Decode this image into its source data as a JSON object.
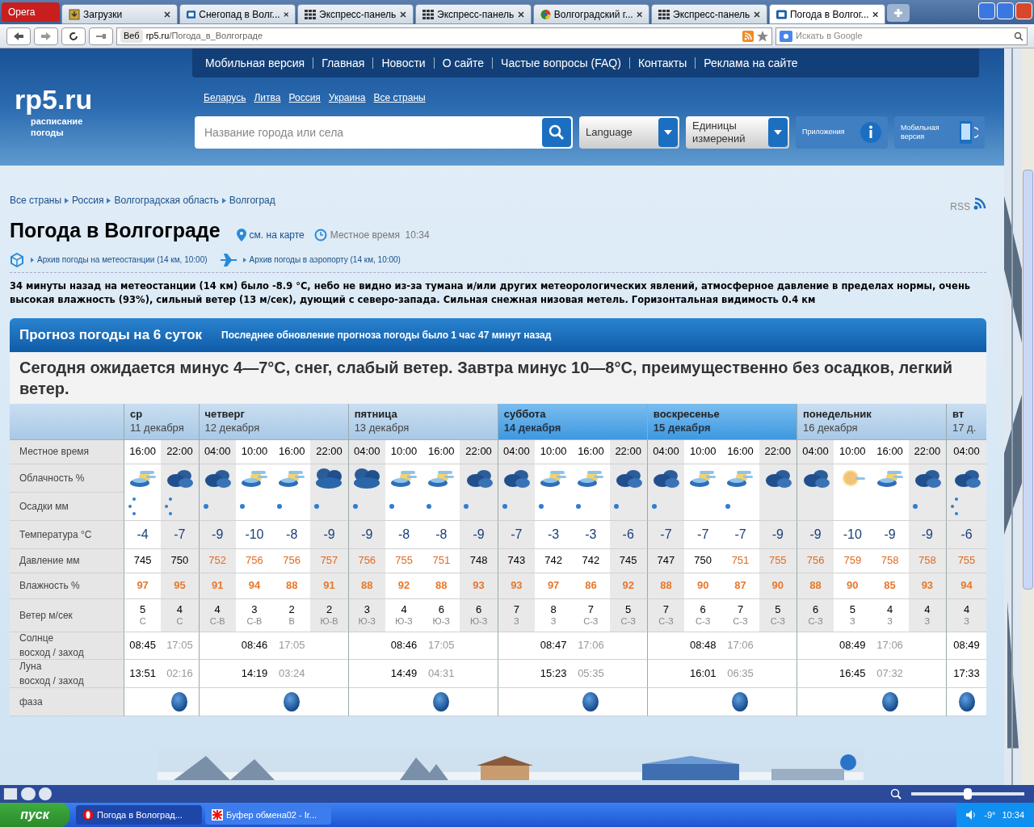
{
  "browser": {
    "menu": "Opera",
    "tabs": [
      {
        "label": "Загрузки",
        "kind": "download",
        "selected": false
      },
      {
        "label": "Снегопад в Волг...",
        "kind": "site",
        "selected": false
      },
      {
        "label": "Экспресс-панель",
        "kind": "grid",
        "selected": false
      },
      {
        "label": "Экспресс-панель",
        "kind": "grid",
        "selected": false
      },
      {
        "label": "Волгоградский г...",
        "kind": "globe",
        "selected": false
      },
      {
        "label": "Экспресс-панель",
        "kind": "grid",
        "selected": false
      },
      {
        "label": "Погода в Волгог...",
        "kind": "site",
        "selected": true
      }
    ],
    "badge": "Веб",
    "url_host": "rp5.ru",
    "url_path": "/Погода_в_Волгограде",
    "search_placeholder": "Искать в Google",
    "zoom": {
      "level": 0.5
    }
  },
  "header": {
    "nav": [
      "Мобильная версия",
      "Главная",
      "Новости",
      "О сайте",
      "Частые вопросы (FAQ)",
      "Контакты",
      "Реклама на сайте"
    ],
    "countries": [
      "Беларусь",
      "Литва",
      "Россия",
      "Украина",
      "Все страны"
    ],
    "logo": "rp5.ru",
    "tagline": "расписание погоды",
    "search_placeholder": "Название города или села",
    "language": "Language",
    "units": "Единицы измерений",
    "apps": "Приложения",
    "mobile": "Мобильная версия"
  },
  "breadcrumbs": [
    "Все страны",
    "Россия",
    "Волгоградская область",
    "Волгоград"
  ],
  "rss": "RSS",
  "title": "Погода в Волгограде",
  "map_link": "см. на карте",
  "local_time": "Местное время  10:34",
  "archives": [
    "Архив погоды на метеостанции (14 км, 10:00)",
    "Архив погоды в аэропорту (14 км, 10:00)"
  ],
  "observation": "34 минуты назад на метеостанции (14 км) было -8.9 °C, небо не видно из-за тумана и/или других метеорологических явлений, атмосферное давление в пределах нормы, очень высокая влажность (93%), сильный ветер (13 м/сек), дующий с северо-запада. Сильная снежная низовая метель. Горизонтальная видимость 0.4 км",
  "forecast": {
    "title": "Прогноз погоды на 6 суток",
    "updated": "Последнее обновление прогноза погоды было 1 час 47 минут назад",
    "summary": "Сегодня ожидается минус 4—7°C, снег, слабый ветер. Завтра минус 10—8°C, преимущественно без осадков, легкий ветер.",
    "row_labels": [
      {
        "title": "Местное время"
      },
      {
        "title": "Облачность %"
      },
      {
        "title": "Осадки мм"
      },
      {
        "title": "Температура °C"
      },
      {
        "title": "Давление мм"
      },
      {
        "title": "Влажность %"
      },
      {
        "title": "Ветер м/сек"
      },
      {
        "title": "Солнце",
        "sub": "восход / заход"
      },
      {
        "title": "Луна",
        "sub": "восход / заход"
      },
      {
        "title": "фаза"
      }
    ],
    "days": [
      {
        "name": "ср",
        "date": "11 декабря",
        "weekend": false,
        "slots": [
          {
            "time": "16:00",
            "shaded": false,
            "sky": {
              "kind": "partly"
            },
            "precip": {
              "kind": "snow"
            },
            "temp": "-4",
            "pressure": "745",
            "high": false,
            "humidity": "97",
            "wind": "5",
            "dir": "С",
            "sun": {
              "text": "08:45",
              "set": false
            },
            "moon": {
              "text": "13:51",
              "set": false
            },
            "phase": false
          },
          {
            "time": "22:00",
            "shaded": true,
            "sky": {
              "kind": "cloudy"
            },
            "precip": {
              "kind": "snow"
            },
            "temp": "-7",
            "pressure": "750",
            "high": false,
            "humidity": "95",
            "wind": "4",
            "dir": "С",
            "sun": {
              "text": "17:05",
              "set": true
            },
            "moon": {
              "text": "02:16",
              "set": true
            },
            "phase": true
          }
        ]
      },
      {
        "name": "четверг",
        "date": "12 декабря",
        "weekend": false,
        "slots": [
          {
            "time": "04:00",
            "shaded": true,
            "sky": {
              "kind": "cloudy"
            },
            "precip": {
              "kind": "light"
            },
            "temp": "-9",
            "pressure": "752",
            "high": true,
            "humidity": "91",
            "wind": "4",
            "dir": "С-В",
            "phase": false
          },
          {
            "time": "10:00",
            "shaded": false,
            "sky": {
              "kind": "partly"
            },
            "precip": {
              "kind": "light"
            },
            "temp": "-10",
            "pressure": "756",
            "high": true,
            "humidity": "94",
            "wind": "3",
            "dir": "С-В",
            "sun": {
              "text": "08:46",
              "set": false
            },
            "moon": {
              "text": "14:19",
              "set": false
            },
            "phase": false
          },
          {
            "time": "16:00",
            "shaded": false,
            "sky": {
              "kind": "partly"
            },
            "precip": {
              "kind": "light"
            },
            "temp": "-8",
            "pressure": "756",
            "high": true,
            "humidity": "88",
            "wind": "2",
            "dir": "В",
            "sun": {
              "text": "17:05",
              "set": true
            },
            "moon": {
              "text": "03:24",
              "set": true
            },
            "phase": true
          },
          {
            "time": "22:00",
            "shaded": true,
            "sky": {
              "kind": "overcast"
            },
            "precip": {
              "kind": "light"
            },
            "temp": "-9",
            "pressure": "757",
            "high": true,
            "humidity": "91",
            "wind": "2",
            "dir": "Ю-В",
            "phase": false
          }
        ]
      },
      {
        "name": "пятница",
        "date": "13 декабря",
        "weekend": false,
        "slots": [
          {
            "time": "04:00",
            "shaded": true,
            "sky": {
              "kind": "overcast"
            },
            "precip": {
              "kind": "light"
            },
            "temp": "-9",
            "pressure": "756",
            "high": true,
            "humidity": "88",
            "wind": "3",
            "dir": "Ю-З",
            "phase": false
          },
          {
            "time": "10:00",
            "shaded": false,
            "sky": {
              "kind": "partly"
            },
            "precip": {
              "kind": "light"
            },
            "temp": "-8",
            "pressure": "755",
            "high": true,
            "humidity": "92",
            "wind": "4",
            "dir": "Ю-З",
            "sun": {
              "text": "08:46",
              "set": false
            },
            "moon": {
              "text": "14:49",
              "set": false
            },
            "phase": false
          },
          {
            "time": "16:00",
            "shaded": false,
            "sky": {
              "kind": "partly"
            },
            "precip": {
              "kind": "light"
            },
            "temp": "-8",
            "pressure": "751",
            "high": true,
            "humidity": "88",
            "wind": "6",
            "dir": "Ю-З",
            "sun": {
              "text": "17:05",
              "set": true
            },
            "moon": {
              "text": "04:31",
              "set": true
            },
            "phase": true
          },
          {
            "time": "22:00",
            "shaded": true,
            "sky": {
              "kind": "cloudy"
            },
            "precip": {
              "kind": "light"
            },
            "temp": "-9",
            "pressure": "748",
            "high": false,
            "humidity": "93",
            "wind": "6",
            "dir": "Ю-З",
            "phase": false
          }
        ]
      },
      {
        "name": "суббота",
        "date": "14 декабря",
        "weekend": true,
        "slots": [
          {
            "time": "04:00",
            "shaded": true,
            "sky": {
              "kind": "cloudy"
            },
            "precip": {
              "kind": "light"
            },
            "temp": "-7",
            "pressure": "743",
            "high": false,
            "humidity": "93",
            "wind": "7",
            "dir": "З",
            "phase": false
          },
          {
            "time": "10:00",
            "shaded": false,
            "sky": {
              "kind": "partly"
            },
            "precip": {
              "kind": "light"
            },
            "temp": "-3",
            "pressure": "742",
            "high": false,
            "humidity": "97",
            "wind": "8",
            "dir": "З",
            "sun": {
              "text": "08:47",
              "set": false
            },
            "moon": {
              "text": "15:23",
              "set": false
            },
            "phase": false
          },
          {
            "time": "16:00",
            "shaded": false,
            "sky": {
              "kind": "partly"
            },
            "precip": {
              "kind": "light"
            },
            "temp": "-3",
            "pressure": "742",
            "high": false,
            "humidity": "86",
            "wind": "7",
            "dir": "С-З",
            "sun": {
              "text": "17:06",
              "set": true
            },
            "moon": {
              "text": "05:35",
              "set": true
            },
            "phase": true
          },
          {
            "time": "22:00",
            "shaded": true,
            "sky": {
              "kind": "cloudy"
            },
            "precip": {
              "kind": "light"
            },
            "temp": "-6",
            "pressure": "745",
            "high": false,
            "humidity": "92",
            "wind": "5",
            "dir": "С-З",
            "phase": false
          }
        ]
      },
      {
        "name": "воскресенье",
        "date": "15 декабря",
        "weekend": true,
        "slots": [
          {
            "time": "04:00",
            "shaded": true,
            "sky": {
              "kind": "cloudy"
            },
            "precip": {
              "kind": "light"
            },
            "temp": "-7",
            "pressure": "747",
            "high": false,
            "humidity": "88",
            "wind": "7",
            "dir": "С-З",
            "phase": false
          },
          {
            "time": "10:00",
            "shaded": false,
            "sky": {
              "kind": "partly"
            },
            "temp": "-7",
            "pressure": "750",
            "high": false,
            "humidity": "90",
            "wind": "6",
            "dir": "С-З",
            "sun": {
              "text": "08:48",
              "set": false
            },
            "moon": {
              "text": "16:01",
              "set": false
            },
            "phase": false
          },
          {
            "time": "16:00",
            "shaded": false,
            "sky": {
              "kind": "partly"
            },
            "precip": {
              "kind": "light"
            },
            "temp": "-7",
            "pressure": "751",
            "high": true,
            "humidity": "87",
            "wind": "7",
            "dir": "С-З",
            "sun": {
              "text": "17:06",
              "set": true
            },
            "moon": {
              "text": "06:35",
              "set": true
            },
            "phase": true
          },
          {
            "time": "22:00",
            "shaded": true,
            "sky": {
              "kind": "cloudy"
            },
            "temp": "-9",
            "pressure": "755",
            "high": true,
            "humidity": "90",
            "wind": "5",
            "dir": "С-З",
            "phase": false
          }
        ]
      },
      {
        "name": "понедельник",
        "date": "16 декабря",
        "weekend": false,
        "slots": [
          {
            "time": "04:00",
            "shaded": true,
            "sky": {
              "kind": "cloudy"
            },
            "temp": "-9",
            "pressure": "756",
            "high": true,
            "humidity": "88",
            "wind": "6",
            "dir": "С-З",
            "phase": false
          },
          {
            "time": "10:00",
            "shaded": false,
            "sky": {
              "kind": "sun"
            },
            "temp": "-10",
            "pressure": "759",
            "high": true,
            "humidity": "90",
            "wind": "5",
            "dir": "З",
            "sun": {
              "text": "08:49",
              "set": false
            },
            "moon": {
              "text": "16:45",
              "set": false
            },
            "phase": false
          },
          {
            "time": "16:00",
            "shaded": false,
            "sky": {
              "kind": "partly"
            },
            "temp": "-9",
            "pressure": "758",
            "high": true,
            "humidity": "85",
            "wind": "4",
            "dir": "З",
            "sun": {
              "text": "17:06",
              "set": true
            },
            "moon": {
              "text": "07:32",
              "set": true
            },
            "phase": true
          },
          {
            "time": "22:00",
            "shaded": true,
            "sky": {
              "kind": "cloudy"
            },
            "precip": {
              "kind": "light"
            },
            "temp": "-9",
            "pressure": "758",
            "high": true,
            "humidity": "93",
            "wind": "4",
            "dir": "З",
            "phase": false
          }
        ]
      },
      {
        "name": "вт",
        "date": "17 д.",
        "weekend": false,
        "slots": [
          {
            "time": "04:00",
            "shaded": true,
            "sky": {
              "kind": "cloudy"
            },
            "precip": {
              "kind": "snow"
            },
            "temp": "-6",
            "pressure": "755",
            "high": true,
            "humidity": "94",
            "wind": "4",
            "dir": "З",
            "sun": {
              "text": "08:49",
              "set": false
            },
            "moon": {
              "text": "17:33",
              "set": false
            },
            "phase": true
          }
        ]
      }
    ]
  },
  "taskbar": {
    "start": "пуск",
    "items": [
      {
        "label": "Погода в Волоград...",
        "kind": "opera",
        "selected": true
      },
      {
        "label": "Буфер обмена02 - Ir...",
        "kind": "irfan",
        "selected": false
      }
    ],
    "temp": "-9°",
    "clock": "10:34"
  }
}
